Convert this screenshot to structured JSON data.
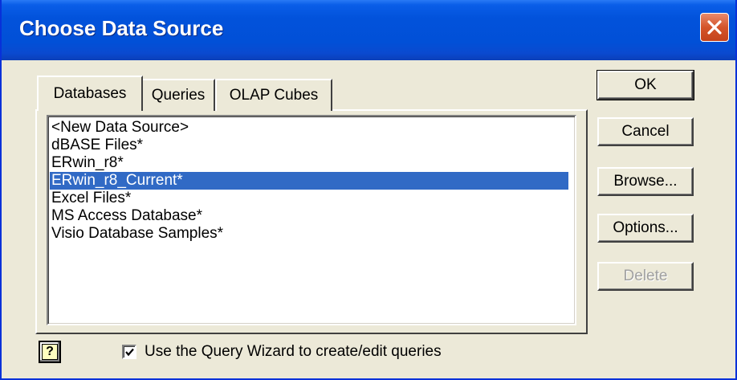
{
  "window": {
    "title": "Choose Data Source",
    "accent_color": "#0252db",
    "close_color": "#d4542a"
  },
  "tabs": [
    {
      "label": "Databases",
      "active": true
    },
    {
      "label": "Queries",
      "active": false
    },
    {
      "label": "OLAP Cubes",
      "active": false
    }
  ],
  "list": {
    "items": [
      {
        "label": "<New Data Source>",
        "selected": false
      },
      {
        "label": "dBASE Files*",
        "selected": false
      },
      {
        "label": "ERwin_r8*",
        "selected": false
      },
      {
        "label": "ERwin_r8_Current*",
        "selected": true
      },
      {
        "label": "Excel Files*",
        "selected": false
      },
      {
        "label": "MS Access Database*",
        "selected": false
      },
      {
        "label": "Visio Database Samples*",
        "selected": false
      }
    ],
    "selection_color": "#316ac5"
  },
  "buttons": {
    "ok": "OK",
    "cancel": "Cancel",
    "browse": "Browse...",
    "options": "Options...",
    "delete": "Delete"
  },
  "footer": {
    "help_glyph": "?",
    "wizard_checkbox_label": "Use the Query Wizard to create/edit queries",
    "wizard_checked": true
  }
}
